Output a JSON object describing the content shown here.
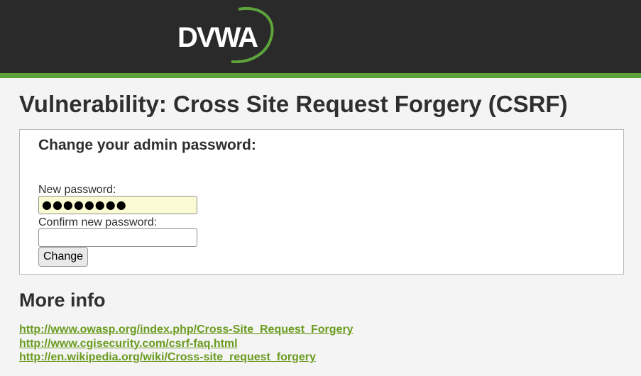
{
  "header": {
    "logo_text": "DVWA",
    "accent_color": "#5da33c",
    "background_color": "#2a2a2a"
  },
  "page": {
    "title": "Vulnerability: Cross Site Request Forgery (CSRF)"
  },
  "form": {
    "heading": "Change your admin password:",
    "new_password_label": "New password:",
    "new_password_value": "●●●●●●●●",
    "confirm_password_label": "Confirm new password:",
    "confirm_password_value": "",
    "submit_label": "Change"
  },
  "more_info": {
    "heading": "More info",
    "link_color": "#6b9b1f",
    "links": [
      "http://www.owasp.org/index.php/Cross-Site_Request_Forgery",
      "http://www.cgisecurity.com/csrf-faq.html",
      "http://en.wikipedia.org/wiki/Cross-site_request_forgery"
    ]
  }
}
